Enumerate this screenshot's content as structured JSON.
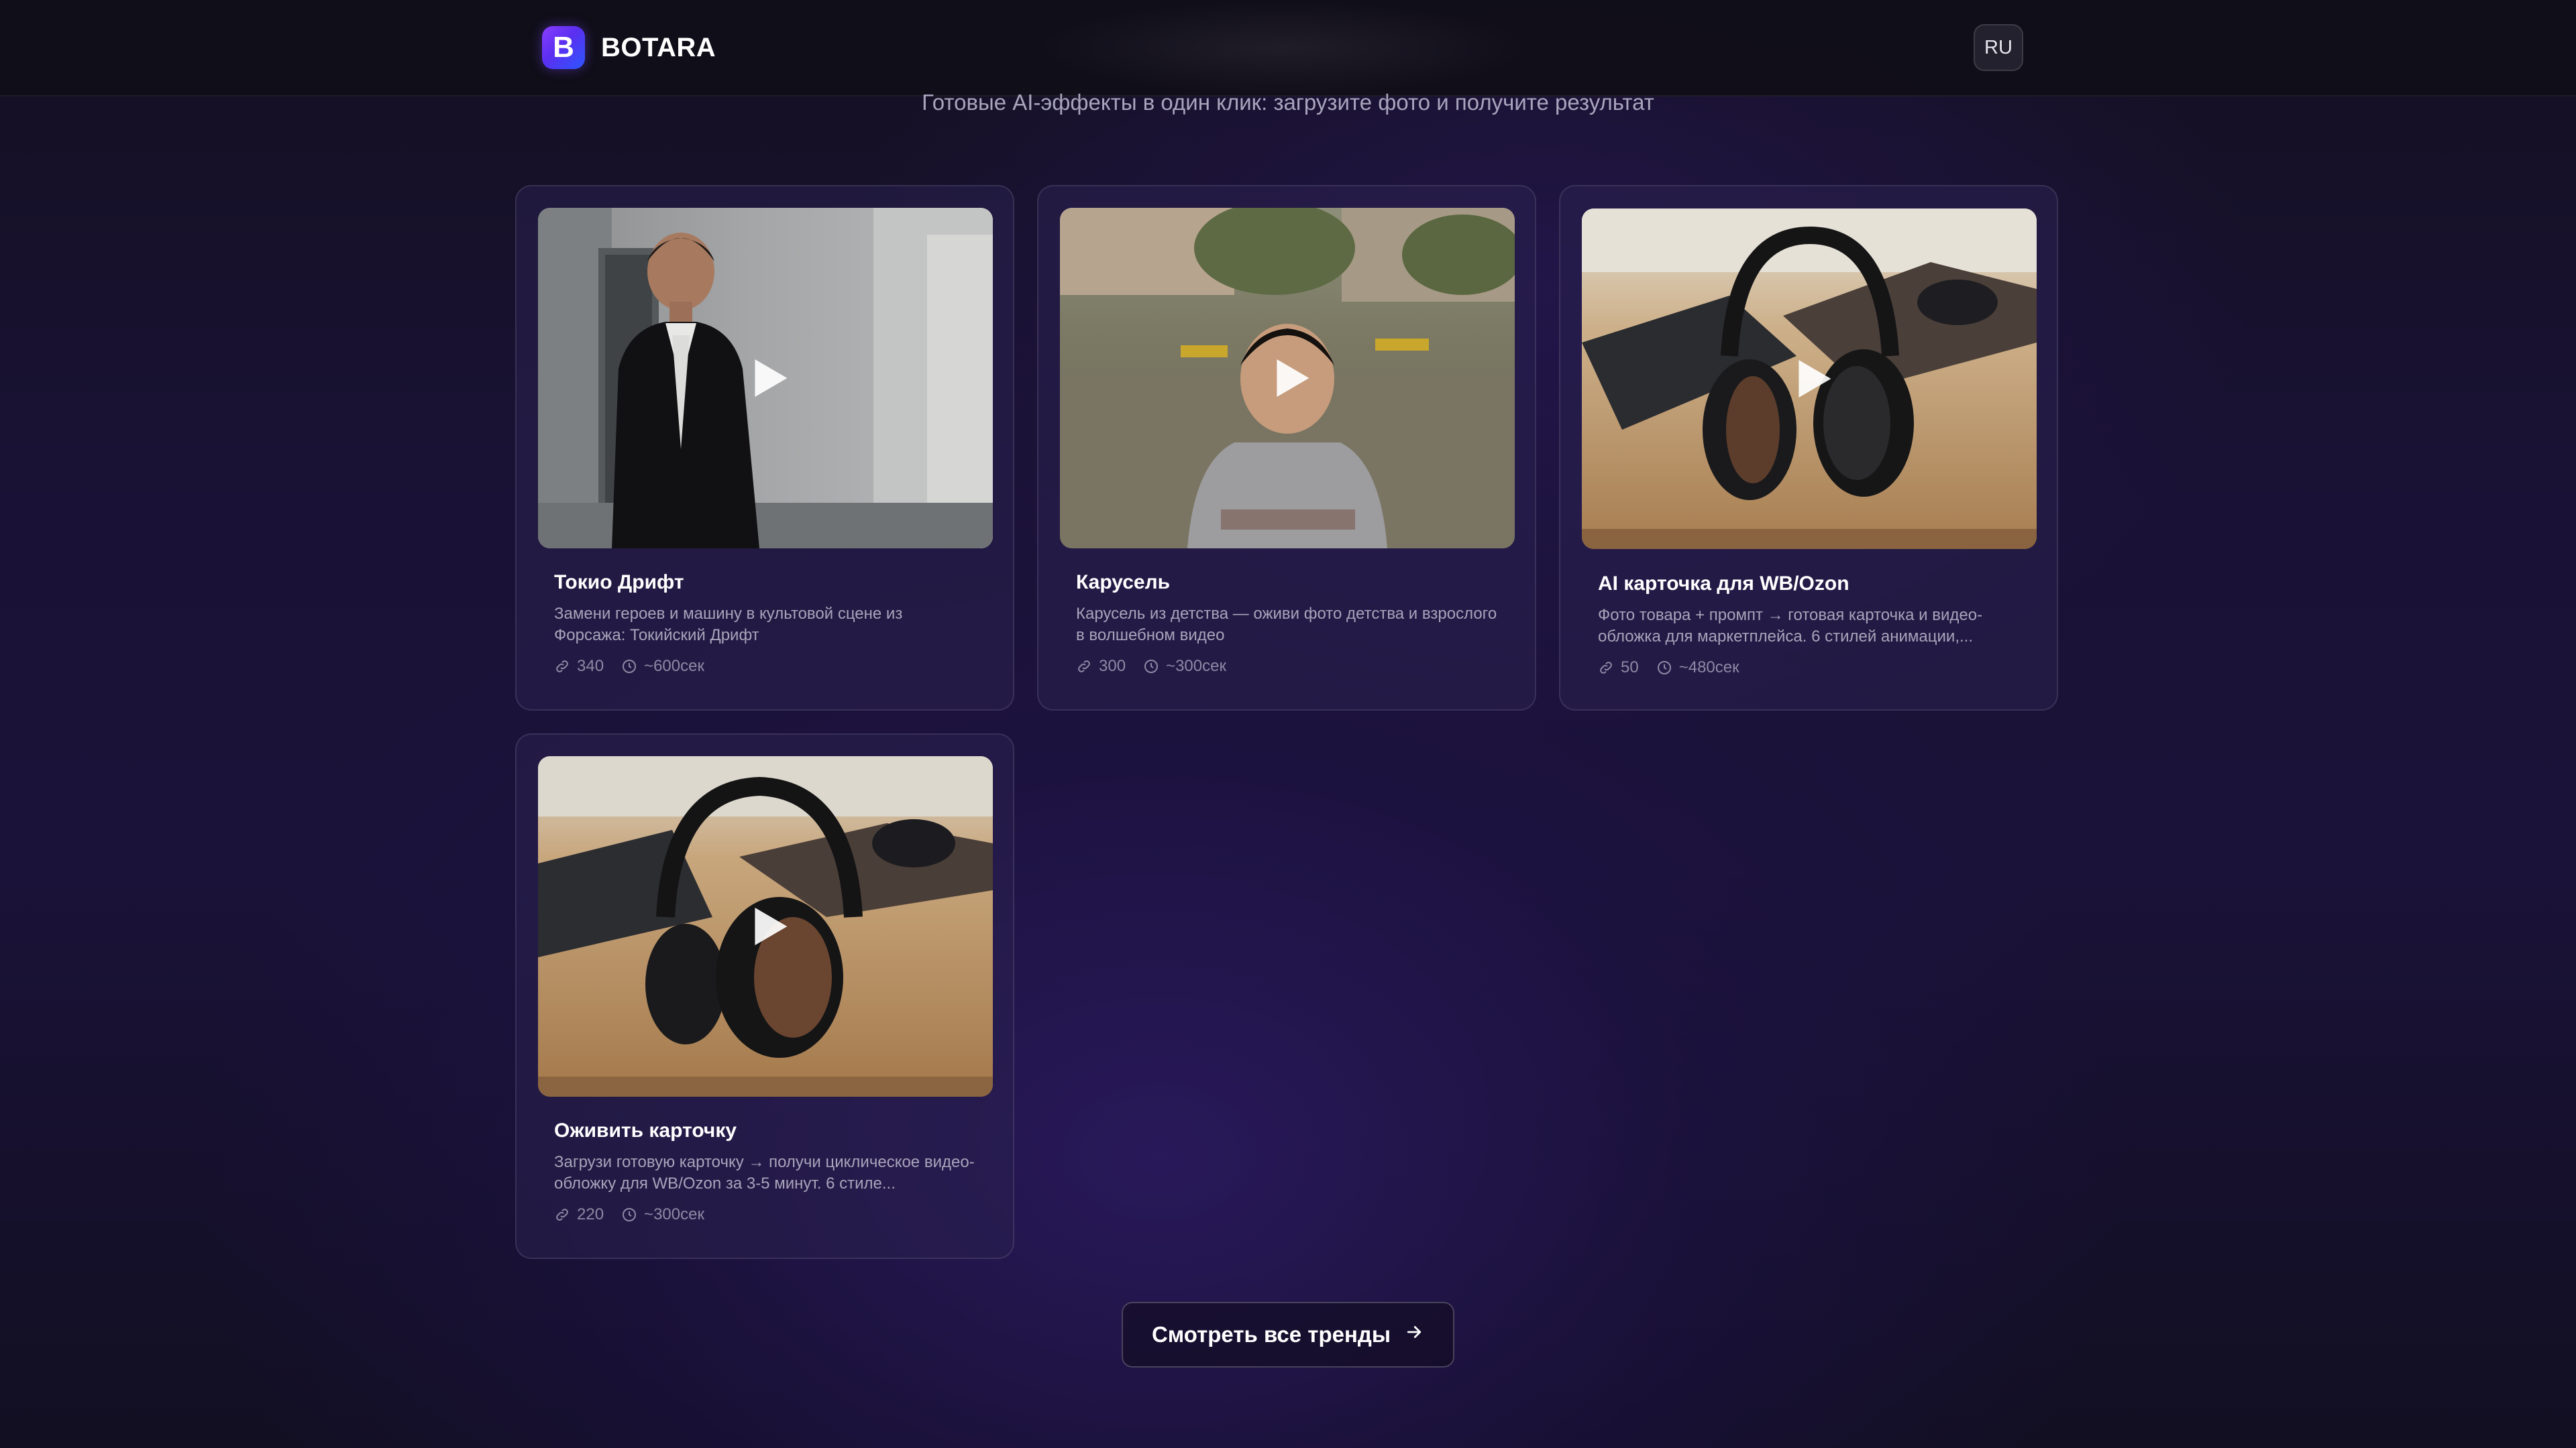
{
  "header": {
    "logo_letter": "B",
    "brand": "BOTARA",
    "language": "RU"
  },
  "subtitle": "Готовые AI-эффекты в один клик: загрузите фото и получите результат",
  "cards": [
    {
      "title": "Токио Дрифт",
      "description": "Замени героев и машину в культовой сцене из Форсажа: Токийский Дрифт",
      "uses": "340",
      "duration": "~600сек",
      "thumbnail_icon": "man-in-jacket-photo"
    },
    {
      "title": "Карусель",
      "description": "Карусель из детства — оживи фото детства и взрослого в волшебном видео",
      "uses": "300",
      "duration": "~300сек",
      "thumbnail_icon": "boy-on-playground-photo"
    },
    {
      "title": "AI карточка для WB/Ozon",
      "description": "Фото товара + промпт → готовая карточка и видео-обложка для маркетплейса. 6 стилей анимации,...",
      "uses": "50",
      "duration": "~480сек",
      "thumbnail_icon": "headphones-on-desk-photo"
    },
    {
      "title": "Оживить карточку",
      "description": "Загрузи готовую карточку → получи циклическое видео-обложку для WB/Ozon за 3-5 минут. 6 стиле...",
      "uses": "220",
      "duration": "~300сек",
      "thumbnail_icon": "headphones-on-desk-photo"
    }
  ],
  "cta": {
    "label": "Смотреть все тренды",
    "icon": "arrow-right-icon"
  },
  "colors": {
    "accent": "#6a35f5",
    "background": "#1a1236",
    "card": "#2a204e"
  }
}
